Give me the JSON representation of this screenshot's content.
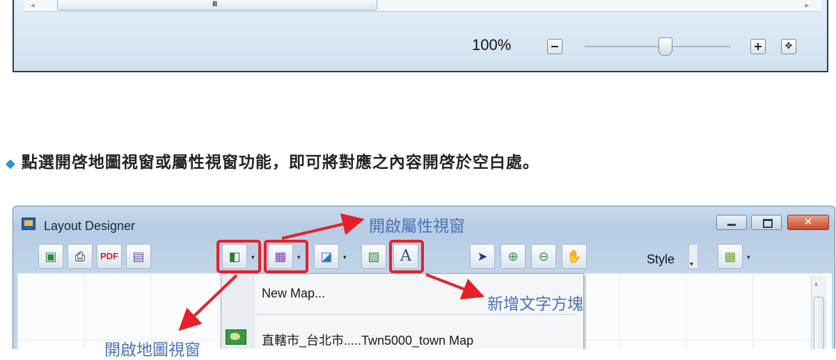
{
  "top_window": {
    "zoom_level": "100%",
    "scroll_grip": "III",
    "slider_level_pct": 55
  },
  "caption": {
    "bullet": "◆",
    "text": "點選開啓地圖視窗或屬性視窗功能，即可將對應之內容開啓於空白處。"
  },
  "window": {
    "title": "Layout Designer",
    "close_glyph": "✕"
  },
  "toolbar": {
    "style_label": "Style",
    "dropdown_glyph": "▾"
  },
  "menu": {
    "items": [
      {
        "label": "New Map..."
      },
      {
        "label": "直轄市_台北市.....Twn5000_town Map"
      }
    ]
  },
  "annotations": {
    "attribute_window": "開啟屬性視窗",
    "add_text_box": "新增文字方塊",
    "map_window": "開啟地圖視窗"
  },
  "colors": {
    "highlight": "#e6202a",
    "annotation_text": "#4b72b8"
  }
}
